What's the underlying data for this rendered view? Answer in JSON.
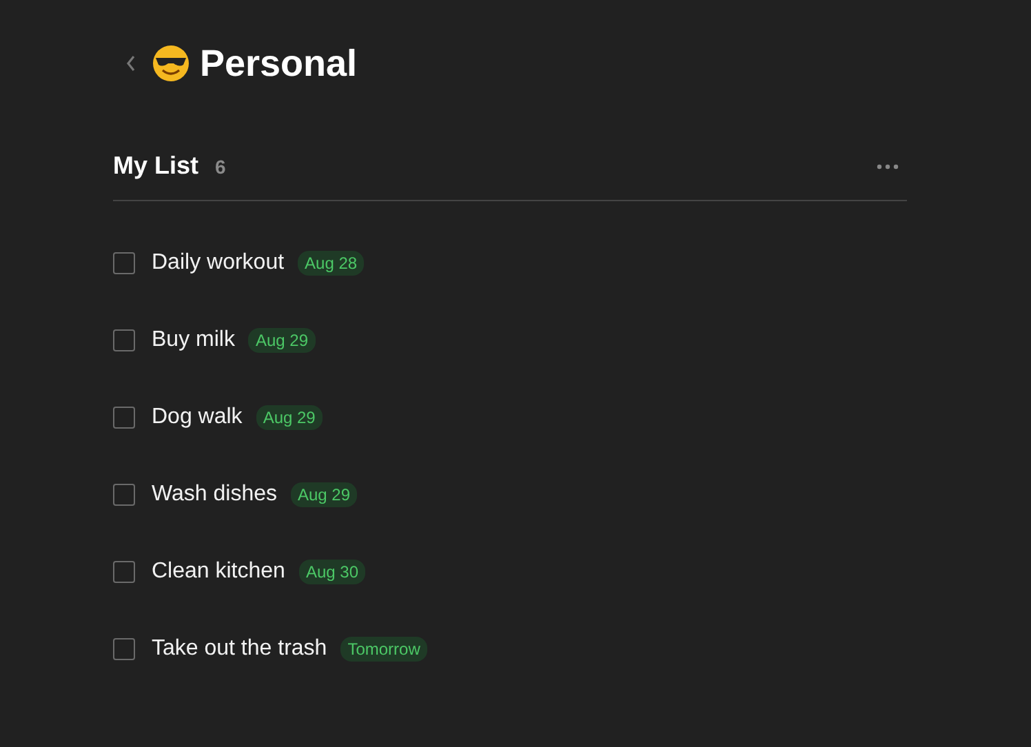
{
  "header": {
    "title": "Personal"
  },
  "list": {
    "title": "My List",
    "count": "6"
  },
  "tasks": [
    {
      "title": "Daily workout",
      "due": "Aug 28",
      "checked": false
    },
    {
      "title": "Buy milk",
      "due": "Aug 29",
      "checked": false
    },
    {
      "title": "Dog walk",
      "due": "Aug 29",
      "checked": false
    },
    {
      "title": "Wash dishes",
      "due": "Aug 29",
      "checked": false
    },
    {
      "title": "Clean kitchen",
      "due": "Aug 30",
      "checked": false
    },
    {
      "title": "Take out the trash",
      "due": "Tomorrow",
      "checked": false
    }
  ]
}
